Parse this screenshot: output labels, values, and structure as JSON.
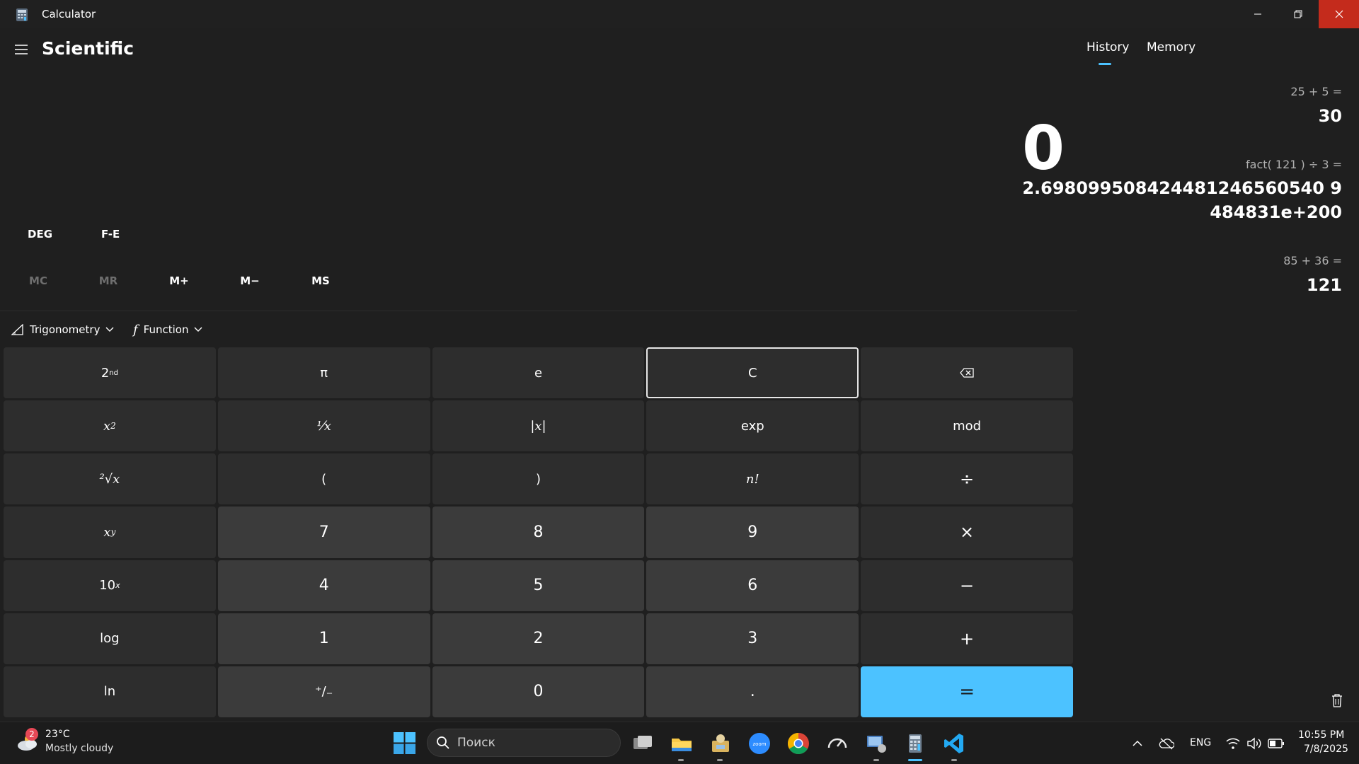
{
  "window": {
    "title": "Calculator",
    "mode_title": "Scientific",
    "display": "0",
    "angle_mode": "DEG",
    "fe_label": "F-E",
    "memory_buttons": [
      {
        "label": "MC",
        "enabled": false
      },
      {
        "label": "MR",
        "enabled": false
      },
      {
        "label": "M+",
        "enabled": true
      },
      {
        "label": "M−",
        "enabled": true
      },
      {
        "label": "MS",
        "enabled": true
      }
    ],
    "dropdowns": {
      "trig": "Trigonometry",
      "func": "Function"
    },
    "keys": {
      "second": "2",
      "second_sup": "nd",
      "pi": "π",
      "e": "e",
      "clear": "C",
      "backspace": "⌫",
      "square_base": "x",
      "square_sup": "2",
      "reciprocal": "⅟x",
      "abs": "|x|",
      "exp": "exp",
      "mod": "mod",
      "sqrt": "²√x",
      "lparen": "(",
      "rparen": ")",
      "fact": "n!",
      "divide": "÷",
      "pow_base": "x",
      "pow_sup": "y",
      "seven": "7",
      "eight": "8",
      "nine": "9",
      "multiply": "×",
      "ten_base": "10",
      "ten_sup": "x",
      "four": "4",
      "five": "5",
      "six": "6",
      "minus": "−",
      "log": "log",
      "one": "1",
      "two": "2",
      "three": "3",
      "plus": "+",
      "ln": "ln",
      "negate": "⁺/₋",
      "zero": "0",
      "decimal": ".",
      "equals": "="
    }
  },
  "history_pane": {
    "tabs": [
      "History",
      "Memory"
    ],
    "active_tab": "History",
    "entries": [
      {
        "expression": "25  +  5 =",
        "result": "30"
      },
      {
        "expression": "fact( 121 )  ÷  3 =",
        "result_line1": "2.698099508424481246560540 9",
        "result_line2": "484831e+200"
      },
      {
        "expression": "85  +  36 =",
        "result": "121"
      }
    ]
  },
  "taskbar": {
    "weather_badge": "2",
    "weather_temp": "23°C",
    "weather_desc": "Mostly cloudy",
    "search_placeholder": "Поиск",
    "language": "ENG",
    "time": "10:55 PM",
    "date": "7/8/2025"
  }
}
